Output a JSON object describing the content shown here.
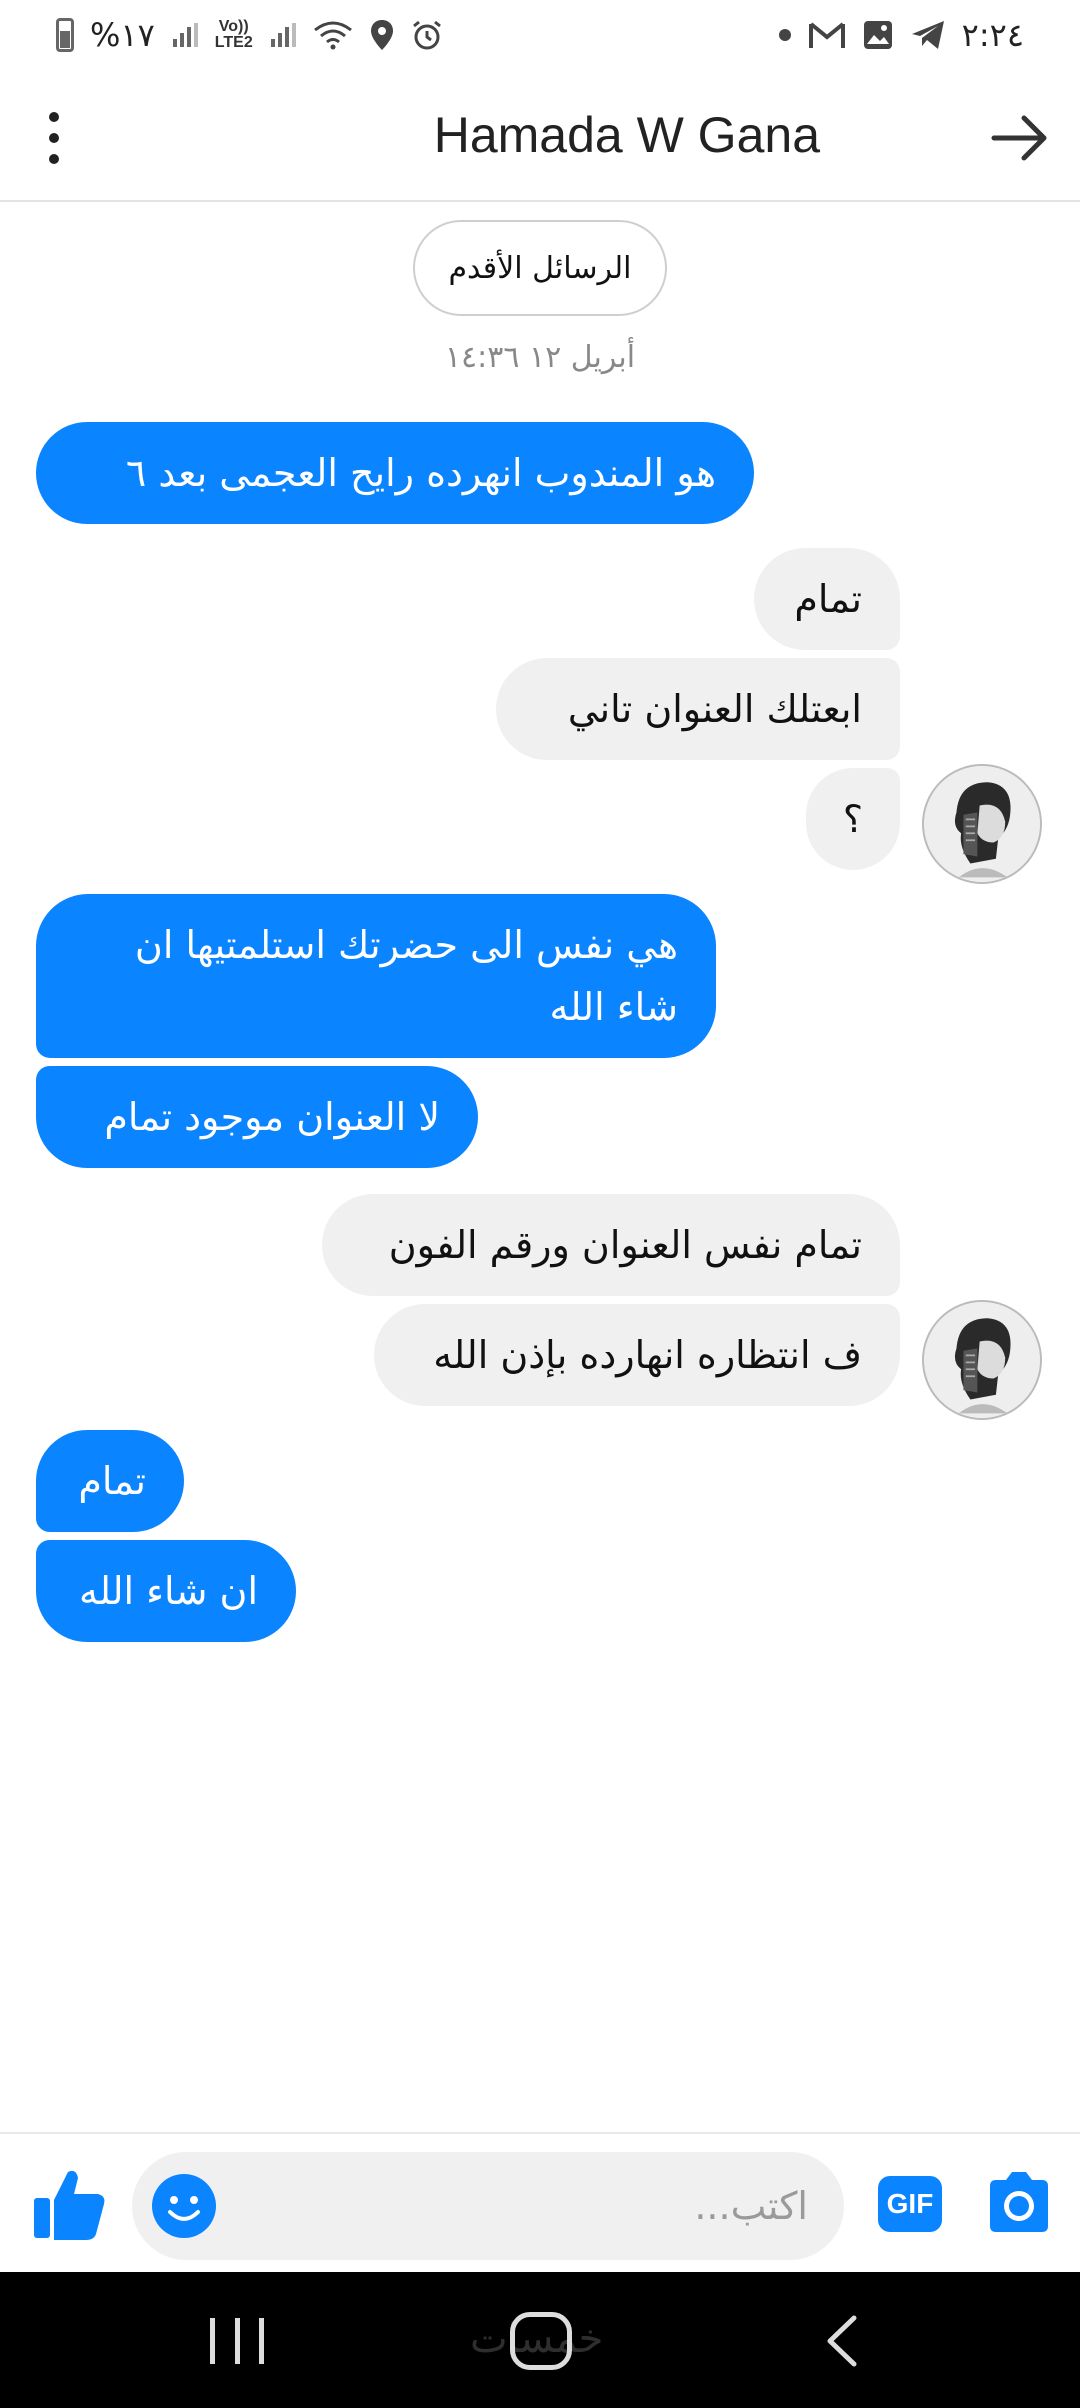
{
  "status_bar": {
    "battery": "%١٧",
    "network": "LTE2",
    "time": "٢:٢٤",
    "icons_left": [
      "battery-icon",
      "signal-icon",
      "volte-icon",
      "signal-icon",
      "wifi-icon",
      "location-icon",
      "alarm-icon"
    ],
    "icons_right": [
      "dot-icon",
      "gmail-icon",
      "gallery-icon",
      "telegram-icon"
    ]
  },
  "header": {
    "contact_name": "Hamada W Gana",
    "back_icon": "arrow-right-icon",
    "menu_icon": "more-vertical-icon"
  },
  "conversation": {
    "older_messages_label": "الرسائل الأقدم",
    "date_stamp": "أبريل ١٢ ١٤:٣٦",
    "messages": [
      {
        "direction": "sent",
        "text": "هو المندوب انهرده رايح العجمى بعد ٦"
      },
      {
        "direction": "received",
        "text": "تمام"
      },
      {
        "direction": "received",
        "text": "ابعتلك العنوان تاني"
      },
      {
        "direction": "received",
        "text": "؟"
      },
      {
        "direction": "sent",
        "text": "هي نفس الى حضرتك استلمتيها ان شاء الله"
      },
      {
        "direction": "sent",
        "text": "لا العنوان موجود تمام"
      },
      {
        "direction": "received",
        "text": "تمام نفس العنوان ورقم الفون"
      },
      {
        "direction": "received",
        "text": "ف انتظاره انهارده بإذن الله"
      },
      {
        "direction": "sent",
        "text": "تمام"
      },
      {
        "direction": "sent",
        "text": "ان شاء الله"
      }
    ]
  },
  "composer": {
    "placeholder": "اكتب...",
    "gif_label": "GIF",
    "like_icon": "thumbs-up-icon",
    "emoji_icon": "emoji-icon",
    "camera_icon": "camera-icon"
  },
  "nav_bar": {
    "watermark": "خمسات"
  },
  "colors": {
    "accent": "#0a84ff",
    "received_bubble": "#f0f0f0",
    "nav_background": "#000000"
  }
}
